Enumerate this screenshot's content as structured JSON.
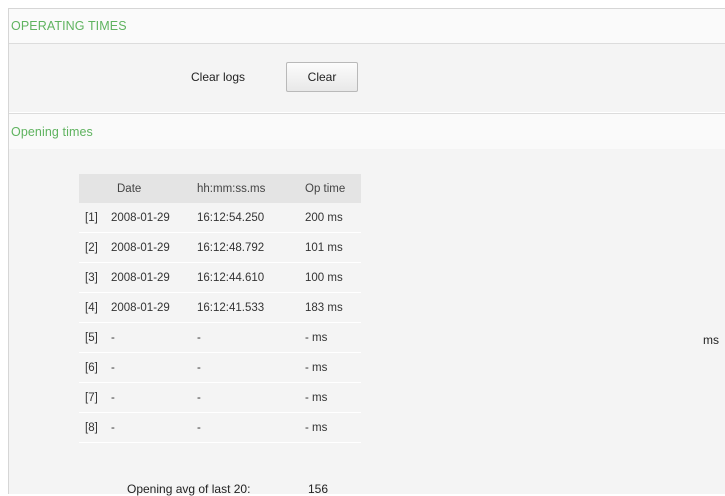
{
  "operating_times": {
    "title": "OPERATING TIMES",
    "clear_logs_label": "Clear logs",
    "clear_button_label": "Clear"
  },
  "opening_times": {
    "title": "Opening times",
    "columns": [
      "",
      "Date",
      "hh:mm:ss.ms",
      "Op time"
    ],
    "rows": [
      {
        "index": "[1]",
        "date": "2008-01-29",
        "time": "16:12:54.250",
        "op_time": "200 ms"
      },
      {
        "index": "[2]",
        "date": "2008-01-29",
        "time": "16:12:48.792",
        "op_time": "101 ms"
      },
      {
        "index": "[3]",
        "date": "2008-01-29",
        "time": "16:12:44.610",
        "op_time": "100 ms"
      },
      {
        "index": "[4]",
        "date": "2008-01-29",
        "time": "16:12:41.533",
        "op_time": "183 ms"
      },
      {
        "index": "[5]",
        "date": "-",
        "time": "-",
        "op_time": "- ms"
      },
      {
        "index": "[6]",
        "date": "-",
        "time": "-",
        "op_time": "- ms"
      },
      {
        "index": "[7]",
        "date": "-",
        "time": "-",
        "op_time": "- ms"
      },
      {
        "index": "[8]",
        "date": "-",
        "time": "-",
        "op_time": "- ms"
      }
    ],
    "average_label": "Opening avg of last 20:",
    "average_value": "156",
    "average_unit": "ms"
  }
}
